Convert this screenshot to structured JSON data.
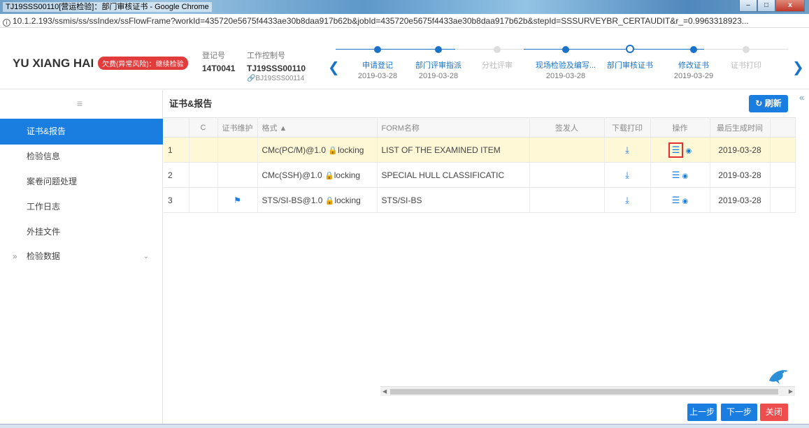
{
  "window": {
    "title": "TJ19SSS00110[营运检验]：部门审核证书 - Google Chrome",
    "min_label": "–",
    "max_label": "□",
    "close_label": "x"
  },
  "url": "10.1.2.193/ssmis/ss/ssIndex/ssFlowFrame?workId=435720e5675f4433ae30b8daa917b62b&jobId=435720e5675f4433ae30b8daa917b62b&stepId=SSSURVEYBR_CERTAUDIT&r_=0.9963318923...",
  "header": {
    "vessel": "YU XIANG HAI",
    "risk": "欠费(异常风险)：继续检验",
    "reg_label": "登记号",
    "reg_value": "14T0041",
    "ctrl_label": "工作控制号",
    "ctrl_value": "TJ19SSS00110",
    "ctrl_sub": "BJ19SSS00114"
  },
  "steps": [
    {
      "label": "申请登记",
      "date": "2019-03-28",
      "state": "done"
    },
    {
      "label": "部门评审指派",
      "date": "2019-03-28",
      "state": "done"
    },
    {
      "label": "分社评审",
      "date": "",
      "state": "skip"
    },
    {
      "label": "现场检验及编写...",
      "date": "2019-03-28",
      "state": "done"
    },
    {
      "label": "部门审核证书",
      "date": "",
      "state": "current"
    },
    {
      "label": "修改证书",
      "date": "2019-03-29",
      "state": "done"
    },
    {
      "label": "证书打印",
      "date": "",
      "state": "todo"
    }
  ],
  "sidebar": {
    "items": [
      {
        "label": "证书&报告"
      },
      {
        "label": "检验信息"
      },
      {
        "label": "案卷问题处理"
      },
      {
        "label": "工作日志"
      },
      {
        "label": "外挂文件"
      },
      {
        "label": "检验数据"
      }
    ]
  },
  "main": {
    "title": "证书&报告",
    "refresh": "刷新",
    "columns": [
      "",
      "C",
      "证书维护",
      "格式 ▲",
      "FORM名称",
      "签发人",
      "下载打印",
      "操作",
      "最后生成时间"
    ],
    "rows": [
      {
        "no": "1",
        "format": "CMc(PC/M)@1.0",
        "lock": "locking",
        "form": "LIST OF THE EXAMINED ITEM",
        "date": "2019-03-28"
      },
      {
        "no": "2",
        "format": "CMc(SSH)@1.0",
        "lock": "locking",
        "form": "SPECIAL HULL CLASSIFICATIC",
        "date": "2019-03-28"
      },
      {
        "no": "3",
        "format": "STS/SI-BS@1.0",
        "lock": "locking",
        "form": "STS/SI-BS",
        "date": "2019-03-28"
      }
    ],
    "prev": "上一步",
    "next": "下一步",
    "close": "关闭"
  },
  "colors": {
    "accent": "#1a7de0",
    "risk": "#e23b3b",
    "selected_row": "#fff8d6",
    "close_button": "#ee4d4d"
  }
}
